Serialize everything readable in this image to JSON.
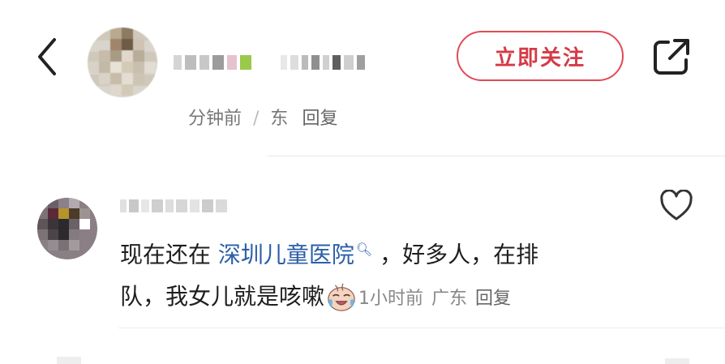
{
  "header": {
    "follow_label": "立即关注",
    "colors": {
      "accent": "#e24a56"
    }
  },
  "post_meta": {
    "time_fragment": "分钟前",
    "location_fragment": "东",
    "reply_label": "回复"
  },
  "comment": {
    "text_before": "现在还在 ",
    "link_text": "深圳儿童医院",
    "text_after_1": " ，好多人，在排",
    "line2": "队，我女儿就是咳嗽",
    "time": "1小时前",
    "location": "广东",
    "reply_label": "回复",
    "emoji": "crying-laughing-face"
  },
  "icons": {
    "back": "chevron-left-icon",
    "share": "share-icon",
    "like": "heart-icon",
    "search": "search-icon"
  }
}
